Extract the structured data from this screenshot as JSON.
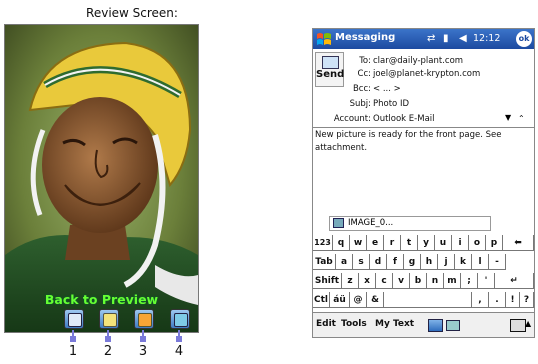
{
  "review": {
    "title": "Review Screen:",
    "overlay_label": "Back to Preview",
    "buttons": [
      {
        "icon": "camera-icon"
      },
      {
        "icon": "envelope-icon"
      },
      {
        "icon": "trash-icon"
      },
      {
        "icon": "image-icon"
      }
    ],
    "callouts": [
      "1",
      "2",
      "3",
      "4"
    ]
  },
  "phone": {
    "app_title": "Messaging",
    "clock": "12:12",
    "ok": "ok",
    "send_label": "Send",
    "headers": [
      {
        "label": "To:",
        "value": "clar@daily-plant.com"
      },
      {
        "label": "Cc:",
        "value": "joel@planet-krypton.com"
      },
      {
        "label": "Bcc:",
        "value": "< ... >"
      },
      {
        "label": "Subj:",
        "value": "Photo ID"
      },
      {
        "label": "Account:",
        "value": "Outlook E-Mail"
      }
    ],
    "body": "New picture is ready for the front page.  See attachment.",
    "attachment": "IMAGE_0...",
    "keyboard": [
      [
        "123",
        "q",
        "w",
        "e",
        "r",
        "t",
        "y",
        "u",
        "i",
        "o",
        "p",
        "⬅"
      ],
      [
        "Tab",
        "a",
        "s",
        "d",
        "f",
        "g",
        "h",
        "j",
        "k",
        "l",
        "-"
      ],
      [
        "Shift",
        "z",
        "x",
        "c",
        "v",
        "b",
        "n",
        "m",
        ";",
        "'",
        "↵"
      ],
      [
        "Ctl",
        "áü",
        "@",
        "&",
        "",
        ",",
        ".",
        "!",
        "?"
      ]
    ],
    "menu": [
      "Edit",
      "Tools",
      "My Text"
    ]
  },
  "colors": {
    "titlebar": "#1c4aa0",
    "overlay_label": "#66ff33",
    "callout": "#7a7ad9"
  }
}
